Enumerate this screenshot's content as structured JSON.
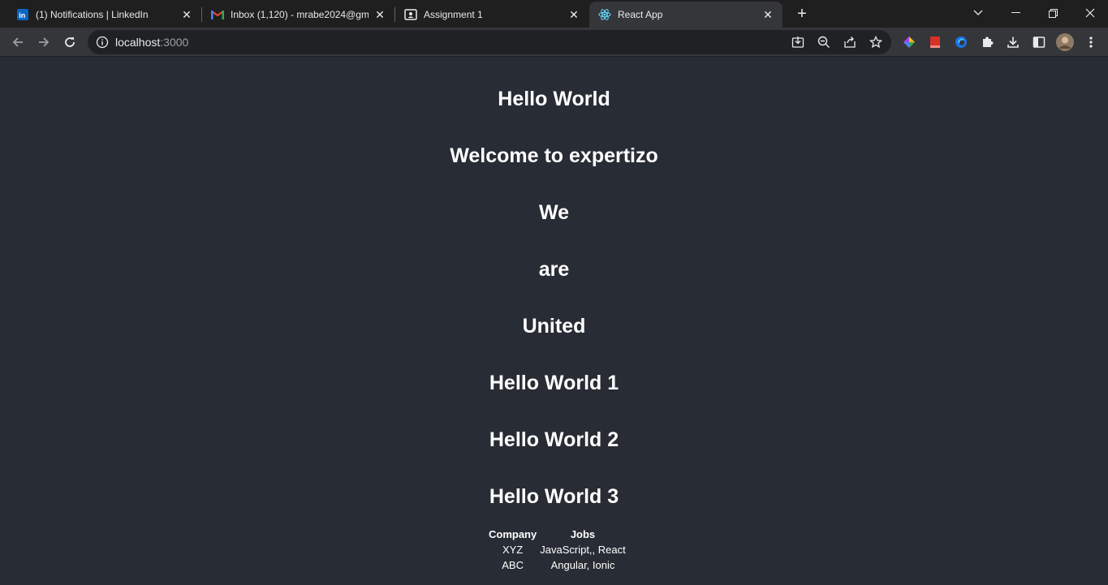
{
  "browser": {
    "tabs": [
      {
        "title": "(1) Notifications | LinkedIn",
        "icon": "linkedin-icon"
      },
      {
        "title": "Inbox (1,120) - mrabe2024@gma",
        "icon": "gmail-icon"
      },
      {
        "title": "Assignment 1",
        "icon": "contact-card-icon"
      },
      {
        "title": "React App",
        "icon": "react-icon"
      }
    ],
    "address": {
      "host": "localhost",
      "port": ":3000"
    }
  },
  "page": {
    "headings": [
      "Hello World",
      "Welcome to expertizo",
      "We",
      "are",
      "United",
      "Hello World 1",
      "Hello World 2",
      "Hello World 3"
    ],
    "table": {
      "headers": [
        "Company",
        "Jobs"
      ],
      "rows": [
        [
          "XYZ",
          "JavaScript,, React"
        ],
        [
          "ABC",
          "Angular, Ionic"
        ]
      ]
    }
  },
  "colors": {
    "page_bg": "#282c34",
    "text": "#ffffff",
    "react_blue": "#61dafb"
  }
}
